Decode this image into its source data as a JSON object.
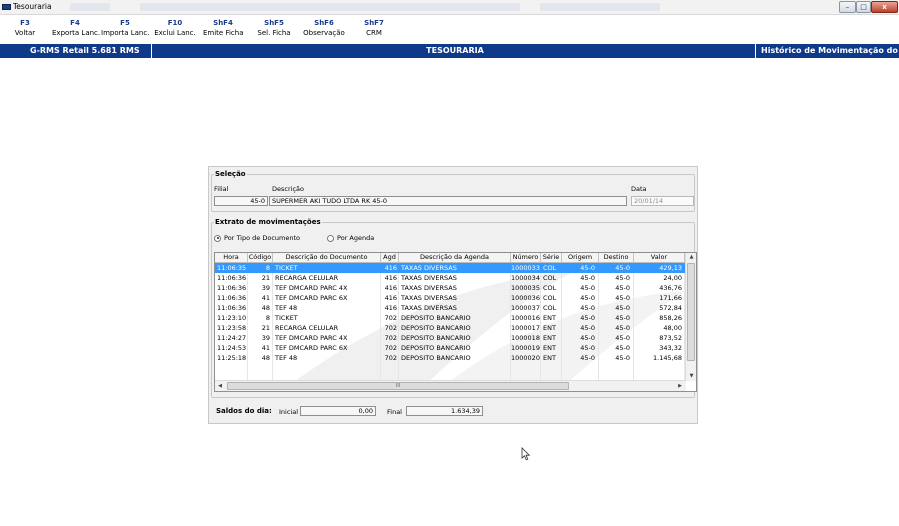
{
  "window": {
    "title": "Tesouraria",
    "controls": {
      "minimize": "–",
      "maximize": "□",
      "close": "x"
    }
  },
  "toolbar": {
    "keys": [
      {
        "key": "F3",
        "label": "Voltar"
      },
      {
        "key": "F4",
        "label": "Exporta Lanc."
      },
      {
        "key": "F5",
        "label": "Importa Lanc."
      },
      {
        "key": "F10",
        "label": "Exclui Lanc."
      },
      {
        "key": "ShF4",
        "label": "Emite Ficha"
      },
      {
        "key": "ShF5",
        "label": "Sel. Ficha"
      },
      {
        "key": "ShF6",
        "label": "Observação"
      },
      {
        "key": "ShF7",
        "label": "CRM"
      }
    ]
  },
  "header": {
    "app_version": "G-RMS Retail 5.681 RMS",
    "module": "TESOURARIA",
    "screen": "Histórico de Movimentação do Cofre"
  },
  "selecao": {
    "title": "Seleção",
    "filial_label": "Filial",
    "filial_value": "45-0",
    "descricao_label": "Descrição",
    "descricao_value": "SUPERMER AKI TUDO LTDA RK 45-0",
    "data_label": "Data",
    "data_value": "20/01/14"
  },
  "extrato": {
    "title": "Extrato de movimentações",
    "radio_tipo": "Por Tipo de Documento",
    "radio_agenda": "Por Agenda",
    "radio_selected": "tipo",
    "columns": [
      "Hora",
      "Código",
      "Descrição do Documento",
      "Agd",
      "Descrição da Agenda",
      "Número",
      "Série",
      "Origem",
      "Destino",
      "Valor"
    ],
    "rows": [
      [
        "11:06:35",
        "8",
        "TICKET",
        "416",
        "TAXAS DIVERSAS",
        "1000033",
        "COL",
        "45-0",
        "45-0",
        "429,13"
      ],
      [
        "11:06:36",
        "21",
        "RECARGA CELULAR",
        "416",
        "TAXAS DIVERSAS",
        "1000034",
        "COL",
        "45-0",
        "45-0",
        "24,00"
      ],
      [
        "11:06:36",
        "39",
        "TEF DMCARD PARC 4X",
        "416",
        "TAXAS DIVERSAS",
        "1000035",
        "COL",
        "45-0",
        "45-0",
        "436,76"
      ],
      [
        "11:06:36",
        "41",
        "TEF DMCARD PARC 6X",
        "416",
        "TAXAS DIVERSAS",
        "1000036",
        "COL",
        "45-0",
        "45-0",
        "171,66"
      ],
      [
        "11:06:36",
        "48",
        "TEF 48",
        "416",
        "TAXAS DIVERSAS",
        "1000037",
        "COL",
        "45-0",
        "45-0",
        "572,84"
      ],
      [
        "11:23:10",
        "8",
        "TICKET",
        "702",
        "DEPOSITO BANCARIO",
        "1000016",
        "ENT",
        "45-0",
        "45-0",
        "858,26"
      ],
      [
        "11:23:58",
        "21",
        "RECARGA CELULAR",
        "702",
        "DEPOSITO BANCARIO",
        "1000017",
        "ENT",
        "45-0",
        "45-0",
        "48,00"
      ],
      [
        "11:24:27",
        "39",
        "TEF DMCARD PARC 4X",
        "702",
        "DEPOSITO BANCARIO",
        "1000018",
        "ENT",
        "45-0",
        "45-0",
        "873,52"
      ],
      [
        "11:24:53",
        "41",
        "TEF DMCARD PARC 6X",
        "702",
        "DEPOSITO BANCARIO",
        "1000019",
        "ENT",
        "45-0",
        "45-0",
        "343,32"
      ],
      [
        "11:25:18",
        "48",
        "TEF 48",
        "702",
        "DEPOSITO BANCARIO",
        "1000020",
        "ENT",
        "45-0",
        "45-0",
        "1.145,68"
      ]
    ],
    "selected_row": 0,
    "hscroll_thumb_text": "III"
  },
  "saldos": {
    "title": "Saldos do dia:",
    "inicial_label": "Inicial",
    "inicial_value": "0,00",
    "final_label": "Final",
    "final_value": "1.634,39"
  },
  "colors": {
    "header_blue": "#0f3a8a",
    "key_blue": "#1a3a8c",
    "selection": "#3399ff",
    "panel_bg": "#f0f0f0"
  }
}
